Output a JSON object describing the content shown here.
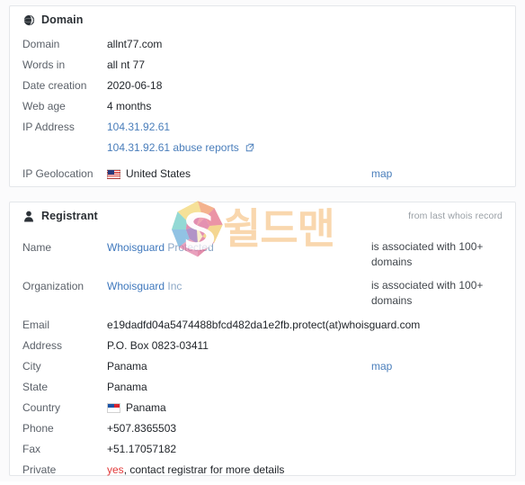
{
  "watermark": {
    "brand_text": "쉴드맨",
    "logo_letter": "S"
  },
  "domain_card": {
    "title": "Domain",
    "icon": "globe-icon",
    "rows": [
      {
        "label": "Domain",
        "value": "allnt77.com"
      },
      {
        "label": "Words in",
        "value": "all nt 77"
      },
      {
        "label": "Date creation",
        "value": "2020-06-18"
      },
      {
        "label": "Web age",
        "value": "4 months"
      },
      {
        "label": "IP Address",
        "value": "104.31.92.61"
      }
    ],
    "abuse_reports_link": "104.31.92.61 abuse reports",
    "geolocation_label": "IP Geolocation",
    "geolocation_value": "United States",
    "geolocation_flag": "us-flag-icon",
    "geolocation_map_link": "map"
  },
  "registrant_card": {
    "title": "Registrant",
    "icon": "person-icon",
    "header_note": "from last whois record",
    "name_label": "Name",
    "name_value_strong": "Whoisguard",
    "name_value_soft": "Protected",
    "name_note": "is associated with 100+ domains",
    "organization_label": "Organization",
    "organization_value_strong": "Whoisguard",
    "organization_value_soft": "Inc",
    "organization_note": "is associated with 100+ domains",
    "rows": [
      {
        "label": "Email",
        "value": "e19dadfd04a5474488bfcd482da1e2fb.protect(at)whoisguard.com"
      },
      {
        "label": "Address",
        "value": "P.O. Box 0823-03411"
      }
    ],
    "city_label": "City",
    "city_value": "Panama",
    "city_map_link": "map",
    "state_label": "State",
    "state_value": "Panama",
    "country_label": "Country",
    "country_value": "Panama",
    "country_flag": "panama-flag-icon",
    "phone_label": "Phone",
    "phone_value": "+507.8365503",
    "fax_label": "Fax",
    "fax_value": "+51.17057182",
    "private_label": "Private",
    "private_value_flag": "yes",
    "private_value_rest": ", contact registrar for more details"
  },
  "colors": {
    "link": "#4a7ebb",
    "link_strong": "#3f78bd",
    "link_soft": "#8ca7c6",
    "label": "#5b6169",
    "value": "#22262b",
    "alert": "#e23b3b",
    "card_border": "#e4e7ea",
    "watermark_text": "#f7c98f"
  }
}
